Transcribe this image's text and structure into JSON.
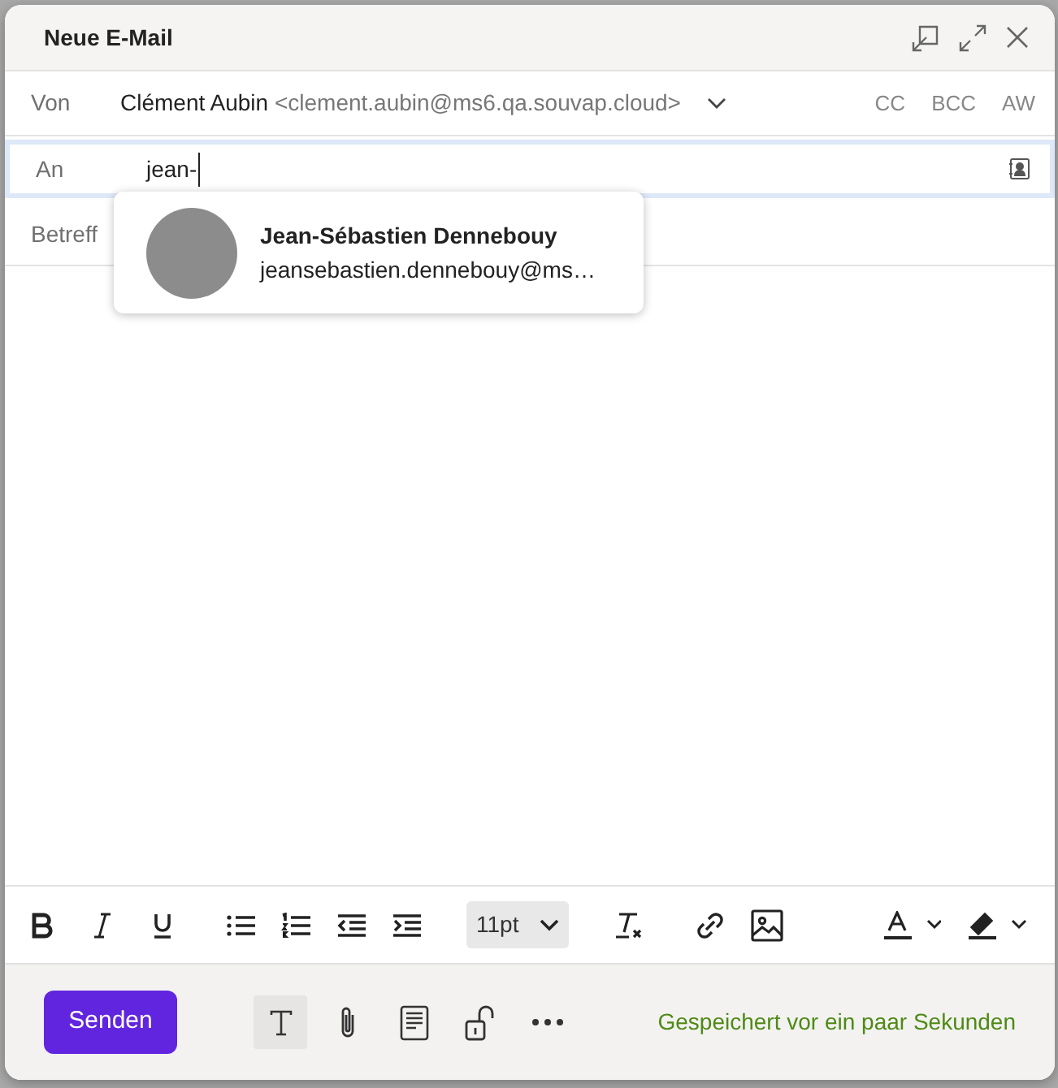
{
  "window": {
    "title": "Neue E-Mail"
  },
  "from": {
    "label": "Von",
    "name": "Clément Aubin",
    "address": "<clement.aubin@ms6.qa.souvap.cloud>"
  },
  "recipient_buttons": [
    "CC",
    "BCC",
    "AW"
  ],
  "to": {
    "label": "An",
    "value": "jean-"
  },
  "suggestions": [
    {
      "name": "Jean-Sébastien Dennebouy",
      "email": "jeansebastien.dennebouy@ms…"
    }
  ],
  "subject": {
    "label": "Betreff"
  },
  "toolbar": {
    "font_size": "11pt"
  },
  "footer": {
    "send": "Senden",
    "format_toggle": {
      "selected": true
    },
    "status": "Gespeichert vor ein paar Sekunden"
  }
}
